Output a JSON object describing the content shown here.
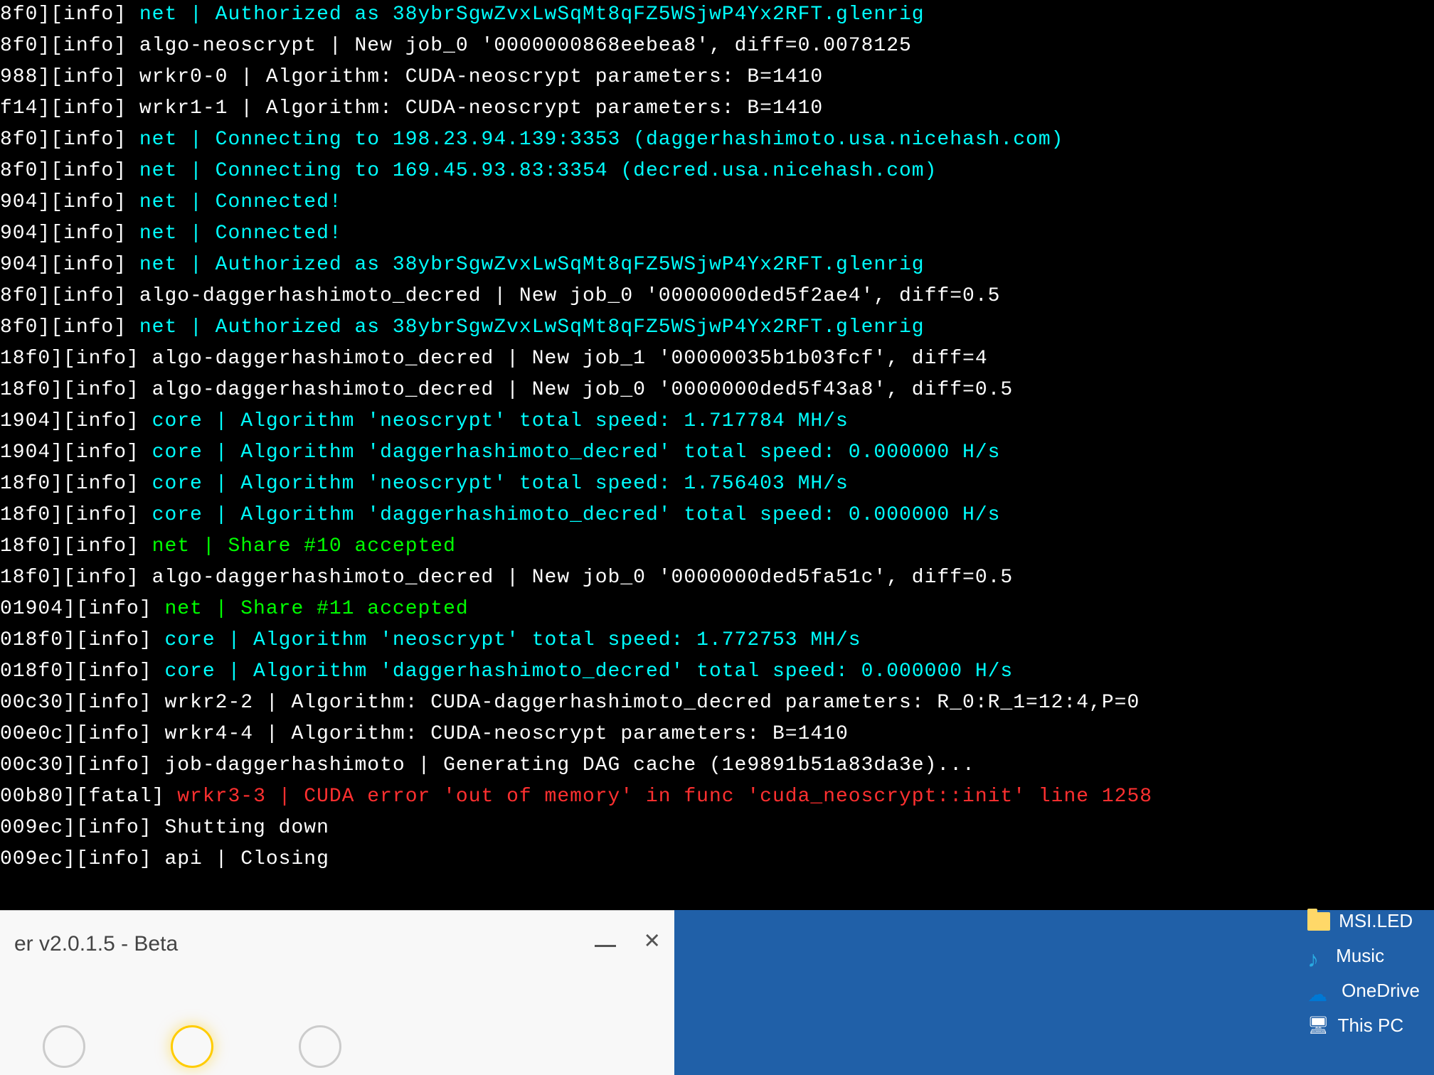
{
  "terminal": {
    "lines": [
      {
        "prefix": "8f0][info]",
        "class": "cyan",
        "text": "net | Authorized as 38ybrSgwZvxLwSqMt8qFZ5WSjwP4Yx2RFT.glenrig"
      },
      {
        "prefix": "8f0][info]",
        "class": "white",
        "text": "algo-neoscrypt | New job_0 '0000000868eebea8', diff=0.0078125"
      },
      {
        "prefix": "988][info]",
        "class": "white",
        "text": "wrkr0-0 | Algorithm: CUDA-neoscrypt parameters: B=1410"
      },
      {
        "prefix": "f14][info]",
        "class": "white",
        "text": "wrkr1-1 | Algorithm: CUDA-neoscrypt parameters: B=1410"
      },
      {
        "prefix": "8f0][info]",
        "class": "cyan",
        "text": "net | Connecting to 198.23.94.139:3353 (daggerhashimoto.usa.nicehash.com)"
      },
      {
        "prefix": "8f0][info]",
        "class": "cyan",
        "text": "net | Connecting to 169.45.93.83:3354 (decred.usa.nicehash.com)"
      },
      {
        "prefix": "904][info]",
        "class": "cyan",
        "text": "net | Connected!"
      },
      {
        "prefix": "904][info]",
        "class": "cyan",
        "text": "net | Connected!"
      },
      {
        "prefix": "904][info]",
        "class": "cyan",
        "text": "net | Authorized as 38ybrSgwZvxLwSqMt8qFZ5WSjwP4Yx2RFT.glenrig"
      },
      {
        "prefix": "8f0][info]",
        "class": "white",
        "text": "algo-daggerhashimoto_decred | New job_0 '0000000ded5f2ae4', diff=0.5"
      },
      {
        "prefix": "8f0][info]",
        "class": "cyan",
        "text": "net | Authorized as 38ybrSgwZvxLwSqMt8qFZ5WSjwP4Yx2RFT.glenrig"
      },
      {
        "prefix": "18f0][info]",
        "class": "white",
        "text": "algo-daggerhashimoto_decred | New job_1 '00000035b1b03fcf', diff=4"
      },
      {
        "prefix": "18f0][info]",
        "class": "white",
        "text": "algo-daggerhashimoto_decred | New job_0 '0000000ded5f43a8', diff=0.5"
      },
      {
        "prefix": "1904][info]",
        "class": "cyan",
        "text": "core | Algorithm 'neoscrypt' total speed: 1.717784 MH/s"
      },
      {
        "prefix": "1904][info]",
        "class": "cyan",
        "text": "core | Algorithm 'daggerhashimoto_decred' total speed: 0.000000 H/s"
      },
      {
        "prefix": "18f0][info]",
        "class": "cyan",
        "text": "core | Algorithm 'neoscrypt' total speed: 1.756403 MH/s"
      },
      {
        "prefix": "18f0][info]",
        "class": "cyan",
        "text": "core | Algorithm 'daggerhashimoto_decred' total speed: 0.000000 H/s"
      },
      {
        "prefix": "18f0][info]",
        "class": "green",
        "text": "net | Share #10 accepted"
      },
      {
        "prefix": "18f0][info]",
        "class": "white",
        "text": "algo-daggerhashimoto_decred | New job_0 '0000000ded5fa51c', diff=0.5"
      },
      {
        "prefix": "01904][info]",
        "class": "green",
        "text": "net | Share #11 accepted"
      },
      {
        "prefix": "018f0][info]",
        "class": "cyan",
        "text": "core | Algorithm 'neoscrypt' total speed: 1.772753 MH/s"
      },
      {
        "prefix": "018f0][info]",
        "class": "cyan",
        "text": "core | Algorithm 'daggerhashimoto_decred' total speed: 0.000000 H/s"
      },
      {
        "prefix": "00c30][info]",
        "class": "white",
        "text": "wrkr2-2 | Algorithm: CUDA-daggerhashimoto_decred parameters: R_0:R_1=12:4,P=0"
      },
      {
        "prefix": "00e0c][info]",
        "class": "white",
        "text": "wrkr4-4 | Algorithm: CUDA-neoscrypt parameters: B=1410"
      },
      {
        "prefix": "00c30][info]",
        "class": "white",
        "text": "job-daggerhashimoto | Generating DAG cache (1e9891b51a83da3e)..."
      },
      {
        "prefix": "00b80][fatal]",
        "class": "red",
        "text": "wrkr3-3 | CUDA error 'out of memory' in func 'cuda_neoscrypt::init' line 1258"
      },
      {
        "prefix": "009ec][info]",
        "class": "white",
        "text": "Shutting down"
      },
      {
        "prefix": "009ec][info]",
        "class": "white",
        "text": "api | Closing"
      }
    ]
  },
  "window": {
    "title": "er v2.0.1.5 - Beta"
  },
  "desktop": {
    "icons": [
      {
        "label": "MSI.LED",
        "type": "folder"
      },
      {
        "label": "Music",
        "type": "music"
      },
      {
        "label": "OneDrive",
        "type": "onedrive"
      },
      {
        "label": "This PC",
        "type": "pc"
      }
    ]
  }
}
